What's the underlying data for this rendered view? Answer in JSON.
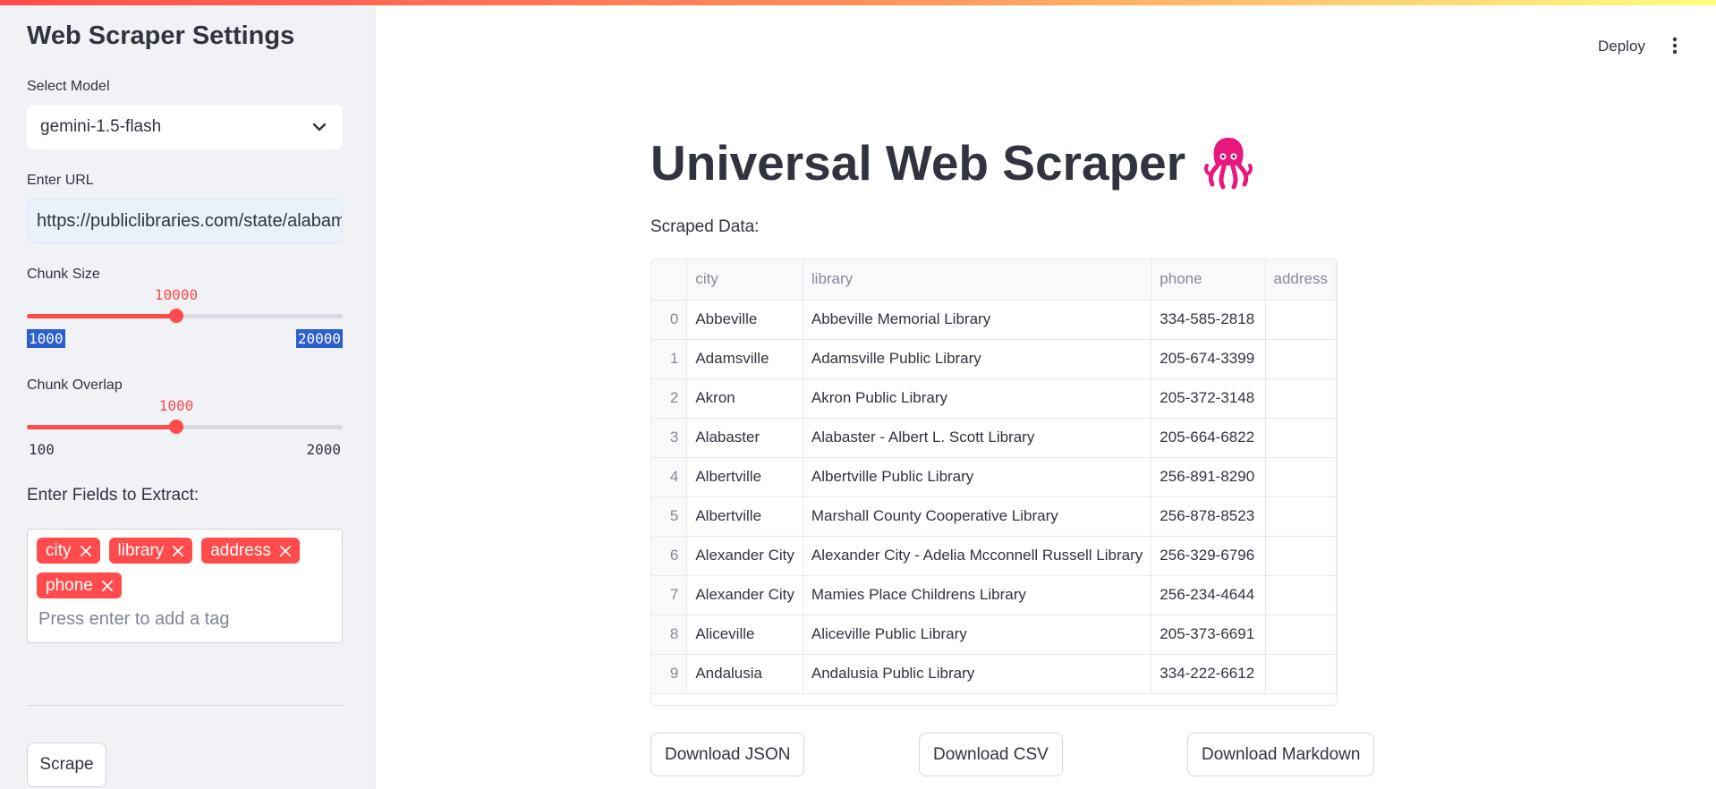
{
  "sidebar": {
    "title": "Web Scraper Settings",
    "model": {
      "label": "Select Model",
      "value": "gemini-1.5-flash"
    },
    "url": {
      "label": "Enter URL",
      "value": "https://publiclibraries.com/state/alabama/"
    },
    "chunk_size": {
      "label": "Chunk Size",
      "value": "10000",
      "min": "1000",
      "max": "20000",
      "fraction": 0.4737
    },
    "chunk_overlap": {
      "label": "Chunk Overlap",
      "value": "1000",
      "min": "100",
      "max": "2000",
      "fraction": 0.4737
    },
    "fields": {
      "label": "Enter Fields to Extract:",
      "tags": [
        "city",
        "library",
        "address",
        "phone"
      ],
      "placeholder": "Press enter to add a tag"
    },
    "scrape_label": "Scrape"
  },
  "header": {
    "deploy_label": "Deploy"
  },
  "main": {
    "title": "Universal Web Scraper",
    "subhead": "Scraped Data:",
    "table": {
      "columns": [
        "city",
        "library",
        "phone",
        "address"
      ],
      "rows": [
        {
          "index": "0",
          "city": "Abbeville",
          "library": "Abbeville Memorial Library",
          "phone": "334-585-2818",
          "address": ""
        },
        {
          "index": "1",
          "city": "Adamsville",
          "library": "Adamsville Public Library",
          "phone": "205-674-3399",
          "address": ""
        },
        {
          "index": "2",
          "city": "Akron",
          "library": "Akron Public Library",
          "phone": "205-372-3148",
          "address": ""
        },
        {
          "index": "3",
          "city": "Alabaster",
          "library": "Alabaster - Albert L. Scott Library",
          "phone": "205-664-6822",
          "address": ""
        },
        {
          "index": "4",
          "city": "Albertville",
          "library": "Albertville Public Library",
          "phone": "256-891-8290",
          "address": ""
        },
        {
          "index": "5",
          "city": "Albertville",
          "library": "Marshall County Cooperative Library",
          "phone": "256-878-8523",
          "address": ""
        },
        {
          "index": "6",
          "city": "Alexander City",
          "library": "Alexander City - Adelia Mcconnell Russell Library",
          "phone": "256-329-6796",
          "address": ""
        },
        {
          "index": "7",
          "city": "Alexander City",
          "library": "Mamies Place Childrens Library",
          "phone": "256-234-4644",
          "address": ""
        },
        {
          "index": "8",
          "city": "Aliceville",
          "library": "Aliceville Public Library",
          "phone": "205-373-6691",
          "address": ""
        },
        {
          "index": "9",
          "city": "Andalusia",
          "library": "Andalusia Public Library",
          "phone": "334-222-6612",
          "address": ""
        }
      ]
    },
    "downloads": {
      "json_label": "Download JSON",
      "csv_label": "Download CSV",
      "md_label": "Download Markdown"
    }
  },
  "icons": {
    "logo": "squid-icon",
    "select_caret": "chevron-down-icon",
    "tag_remove": "close-icon",
    "menu": "kebab-menu-icon"
  },
  "colors": {
    "accent": "#ff4b4b",
    "sidebar_bg": "#f0f2f6",
    "logo": "#e8177d"
  }
}
